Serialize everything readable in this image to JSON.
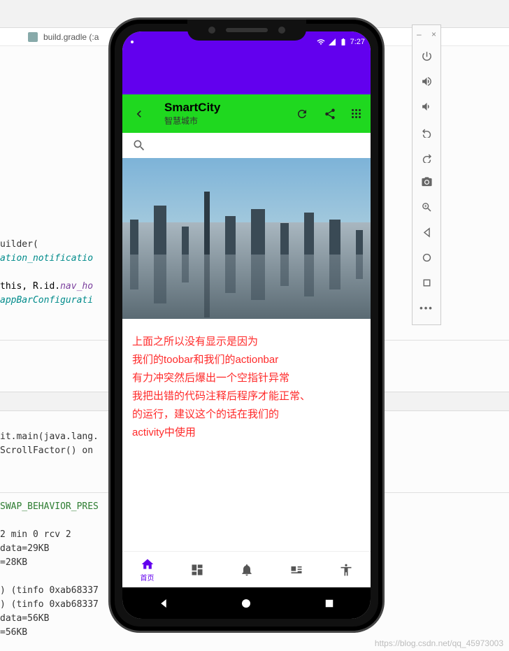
{
  "ide": {
    "tab_file": "build.gradle (:a",
    "code1": [
      {
        "cls": "",
        "txt": "uilder("
      },
      {
        "cls": "kw-teal",
        "txt": "ation_notificatio"
      },
      {
        "cls": "",
        "txt": ""
      },
      {
        "cls": "",
        "txt": "this, R.id.nav_ho",
        "prefix_cls": "kw-purple",
        "prefix": "nav_ho"
      },
      {
        "cls": "kw-teal",
        "txt": "appBarConfigurati"
      }
    ],
    "code1_lines": [
      "uilder(",
      "ation_notificatio",
      "",
      "this, R.id.nav_ho",
      "appBarConfigurati"
    ],
    "code2_lines": [
      "it.main(java.lang.",
      "ScrollFactor() on "
    ],
    "code3_lines": [
      "SWAP_BEHAVIOR_PRES",
      "",
      "2 min 0 rcv 2",
      " data=29KB",
      "=28KB",
      "",
      ") (tinfo 0xab68337",
      ") (tinfo 0xab68337",
      " data=56KB",
      "=56KB"
    ]
  },
  "phone": {
    "status_time": "7:27",
    "toolbar": {
      "title": "SmartCity",
      "subtitle": "智慧城市"
    },
    "annotation": "上面之所以没有显示是因为\n我们的toobar和我们的actionbar\n有力冲突然后爆出一个空指针异常\n我把出错的代码注释后程序才能正常、\n的运行，建议这个的话在我们的\nactivity中使用",
    "bottom_nav": [
      {
        "label": "首页",
        "icon": "home",
        "active": true
      },
      {
        "label": "",
        "icon": "dashboard",
        "active": false
      },
      {
        "label": "",
        "icon": "notifications",
        "active": false
      },
      {
        "label": "",
        "icon": "news",
        "active": false
      },
      {
        "label": "",
        "icon": "accessibility",
        "active": false
      }
    ]
  },
  "emulator_toolbar": {
    "buttons": [
      "power",
      "volume-up",
      "volume-down",
      "rotate-left",
      "rotate-right",
      "camera",
      "zoom",
      "back",
      "home",
      "overview",
      "more"
    ]
  },
  "watermark": "https://blog.csdn.net/qq_45973003"
}
